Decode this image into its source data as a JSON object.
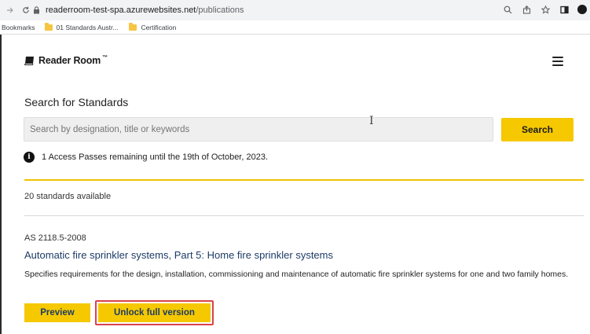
{
  "browser": {
    "url_domain": "readerroom-test-spa.azurewebsites.net",
    "url_path": "/publications",
    "bookmarks_label": "Bookmarks",
    "bookmarks": [
      {
        "label": "01 Standards Austr..."
      },
      {
        "label": "Certification"
      }
    ]
  },
  "header": {
    "brand": "Reader Room",
    "trademark": "™"
  },
  "search": {
    "title": "Search for Standards",
    "placeholder": "Search by designation, title or keywords",
    "button_label": "Search"
  },
  "notice": {
    "icon": "info-icon",
    "text": "1 Access Passes remaining until the 19th of October, 2023."
  },
  "results": {
    "count_text": "20 standards available",
    "items": [
      {
        "designation": "AS 2118.5-2008",
        "title": "Automatic fire sprinkler systems, Part 5: Home fire sprinkler systems",
        "description": "Specifies requirements for the design, installation, commissioning and maintenance of automatic fire sprinkler systems for one and two family homes.",
        "preview_label": "Preview",
        "unlock_label": "Unlock full version"
      }
    ]
  },
  "colors": {
    "accent_yellow": "#f5c800",
    "highlight_red": "#d9424d",
    "title_blue": "#1d3b66"
  }
}
